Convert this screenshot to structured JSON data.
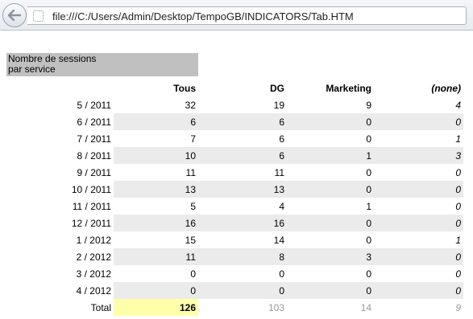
{
  "browser": {
    "url": "file:///C:/Users/Admin/Desktop/TempoGB/INDICATORS/Tab.HTM"
  },
  "report": {
    "title": "Nombre de sessions\npar service",
    "columns": [
      "",
      "Tous",
      "DG",
      "Marketing",
      "(none)"
    ],
    "rows": [
      {
        "period": "5 / 2011",
        "tous": "32",
        "dg": "19",
        "marketing": "9",
        "none": "4"
      },
      {
        "period": "6 / 2011",
        "tous": "6",
        "dg": "6",
        "marketing": "0",
        "none": "0"
      },
      {
        "period": "7 / 2011",
        "tous": "7",
        "dg": "6",
        "marketing": "0",
        "none": "1"
      },
      {
        "period": "8 / 2011",
        "tous": "10",
        "dg": "6",
        "marketing": "1",
        "none": "3"
      },
      {
        "period": "9 / 2011",
        "tous": "11",
        "dg": "11",
        "marketing": "0",
        "none": "0"
      },
      {
        "period": "10 / 2011",
        "tous": "13",
        "dg": "13",
        "marketing": "0",
        "none": "0"
      },
      {
        "period": "11 / 2011",
        "tous": "5",
        "dg": "4",
        "marketing": "1",
        "none": "0"
      },
      {
        "period": "12 / 2011",
        "tous": "16",
        "dg": "16",
        "marketing": "0",
        "none": "0"
      },
      {
        "period": "1 / 2012",
        "tous": "15",
        "dg": "14",
        "marketing": "0",
        "none": "1"
      },
      {
        "period": "2 / 2012",
        "tous": "11",
        "dg": "8",
        "marketing": "3",
        "none": "0"
      },
      {
        "period": "3 / 2012",
        "tous": "0",
        "dg": "0",
        "marketing": "0",
        "none": "0"
      },
      {
        "period": "4 / 2012",
        "tous": "0",
        "dg": "0",
        "marketing": "0",
        "none": "0"
      }
    ],
    "total": {
      "label": "Total",
      "tous": "126",
      "dg": "103",
      "marketing": "14",
      "none": "9"
    },
    "colors": {
      "title_bg": "#c0c0c0",
      "row_shade": "#ebebeb",
      "total_highlight": "#ffffaa",
      "total_dim_text": "#9a9a9a"
    }
  }
}
